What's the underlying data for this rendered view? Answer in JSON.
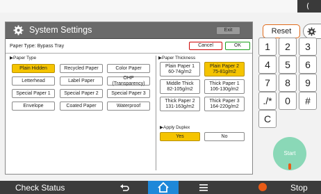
{
  "app_title": "System Settings",
  "exit_label": "Exit",
  "paper_type_label": "Paper Type: Bypass Tray",
  "cancel_label": "Cancel",
  "ok_label": "OK",
  "paper_type_section": "▶Paper Type",
  "paper_thickness_section": "▶Paper Thickness",
  "paper_types": [
    {
      "label": "Plain Hidden",
      "selected": true
    },
    {
      "label": "Recycled Paper",
      "selected": false
    },
    {
      "label": "Color Paper",
      "selected": false
    },
    {
      "label": "Letterhead",
      "selected": false
    },
    {
      "label": "Label Paper",
      "selected": false
    },
    {
      "label": "OHP (Transparency)",
      "selected": false
    },
    {
      "label": "Special Paper 1",
      "selected": false
    },
    {
      "label": "Special Paper 2",
      "selected": false
    },
    {
      "label": "Special Paper 3",
      "selected": false
    },
    {
      "label": "Envelope",
      "selected": false
    },
    {
      "label": "Coated Paper",
      "selected": false
    },
    {
      "label": "Waterproof",
      "selected": false
    }
  ],
  "thickness": [
    {
      "line1": "Plain Paper 1",
      "line2": "60-74g/m2",
      "selected": false
    },
    {
      "line1": "Plain Paper 2",
      "line2": "75-81g/m2",
      "selected": true
    },
    {
      "line1": "Middle Thick",
      "line2": "82-105g/m2",
      "selected": false
    },
    {
      "line1": "Thick Paper 1",
      "line2": "106-130g/m2",
      "selected": false
    },
    {
      "line1": "Thick Paper 2",
      "line2": "131-163g/m2",
      "selected": false
    },
    {
      "line1": "Thick Paper 3",
      "line2": "164-220g/m2",
      "selected": false
    }
  ],
  "duplex_label": "▶Apply Duplex",
  "duplex_yes": "Yes",
  "duplex_no": "No",
  "reset_label": "Reset",
  "keypad": [
    "1",
    "2",
    "3",
    "4",
    "5",
    "6",
    "7",
    "8",
    "9",
    "./*",
    "0",
    "#",
    "C"
  ],
  "start_label": "Start",
  "check_status": "Check Status",
  "stop_label": "Stop",
  "colors": {
    "selected": "#f5c400",
    "start": "#8ad8b7",
    "accent": "#e95b16",
    "home": "#1e88d9"
  }
}
